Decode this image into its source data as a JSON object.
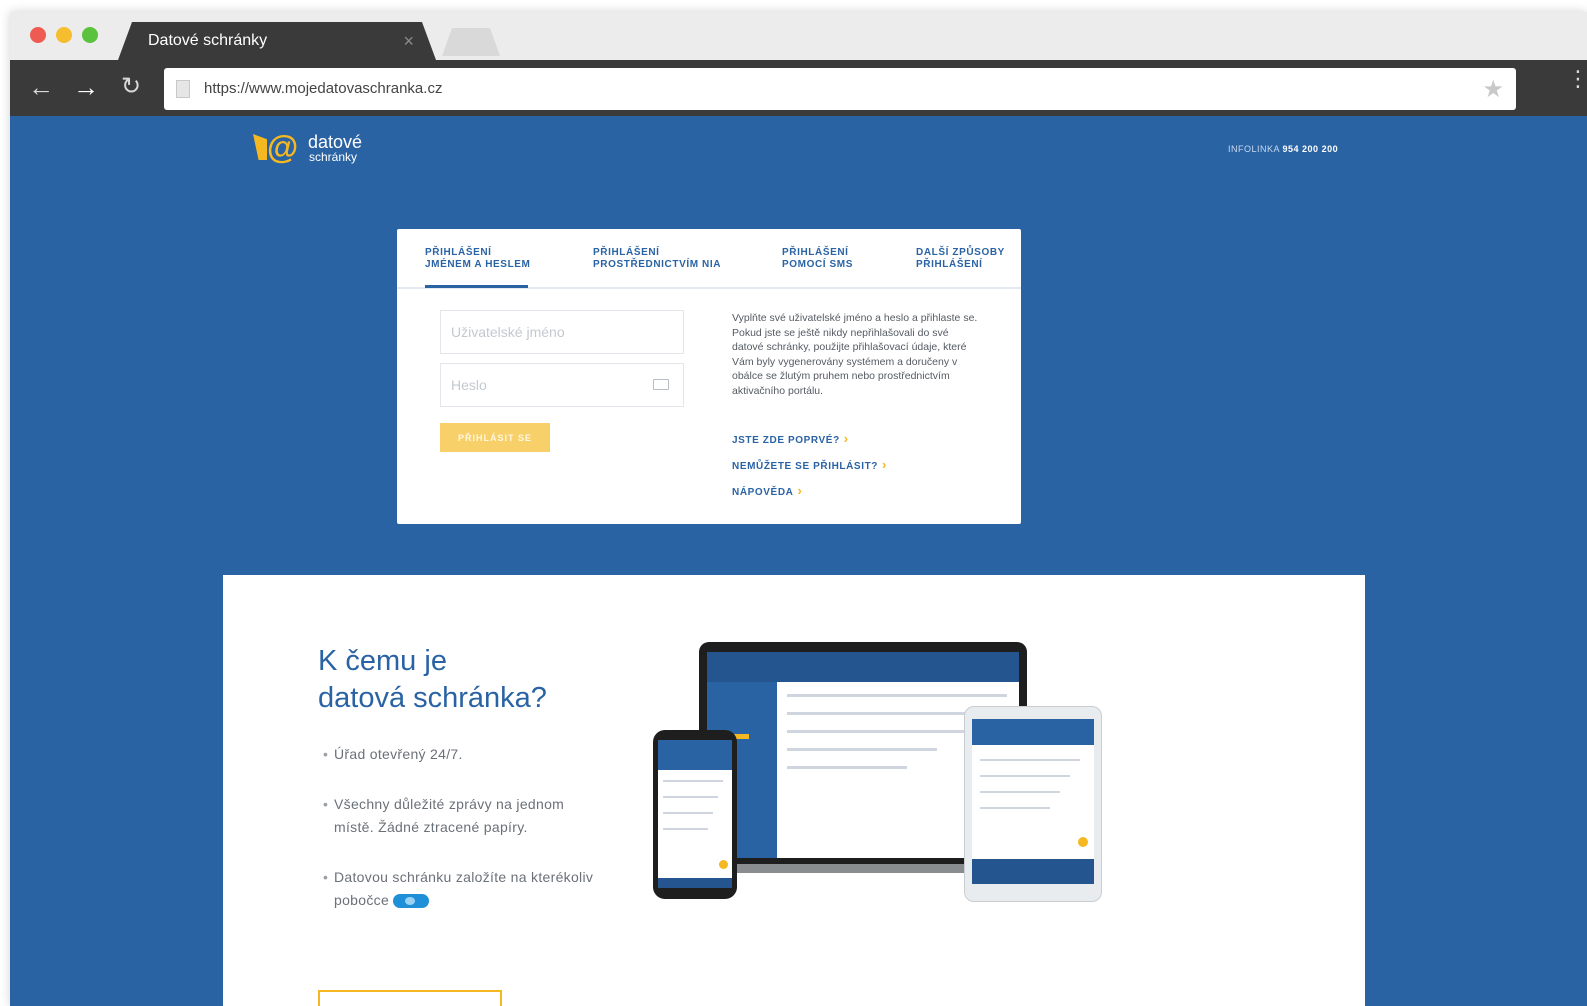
{
  "browser": {
    "tab_title": "Datové schránky",
    "tab_close": "×",
    "url": "https://www.mojedatovaschranka.cz",
    "back": "←",
    "forward": "→",
    "reload": "↻",
    "star": "★",
    "menu": "⋮"
  },
  "header": {
    "logo_at": "@",
    "logo_word_1": "datové",
    "logo_word_2": "schránky",
    "infoline_label": "INFOLINKA",
    "infoline_number": "954 200 200"
  },
  "login": {
    "tabs": [
      {
        "label": "PŘIHLÁŠENÍ\nJMÉNEM A HESLEM",
        "active": true
      },
      {
        "label": "PŘIHLÁŠENÍ\nPROSTŘEDNICTVÍM NIA",
        "active": false
      },
      {
        "label": "PŘIHLÁŠENÍ\nPOMOCÍ SMS",
        "active": false
      },
      {
        "label": "DALŠÍ ZPŮSOBY\nPŘIHLÁŠENÍ",
        "active": false
      }
    ],
    "username_placeholder": "Uživatelské jméno",
    "password_placeholder": "Heslo",
    "submit_label": "PŘIHLÁSIT SE",
    "description": "Vyplňte své uživatelské jméno a heslo a přihlaste se. Pokud jste se ještě nikdy nepřihlašovali do své datové schránky, použijte přihlašovací údaje, které Vám byly vygenerovány systémem a doručeny v obálce se žlutým pruhem nebo prostřednictvím aktivačního portálu.",
    "links": [
      {
        "label": "JSTE ZDE POPRVÉ?",
        "chevron": "›"
      },
      {
        "label": "NEMŮŽETE SE PŘIHLÁSIT?",
        "chevron": "›"
      },
      {
        "label": "NÁPOVĚDA",
        "chevron": "›"
      }
    ]
  },
  "info": {
    "title": "K čemu je\ndatová schránka?",
    "bullets": [
      "Úřad otevřený 24/7.",
      "Všechny důležité zprávy na jednom místě. Žádné ztracené papíry.",
      "Datovou schránku založíte na kterékoliv pobočce"
    ]
  },
  "colors": {
    "brand_blue": "#2a63a4",
    "accent_yellow": "#f5b820"
  }
}
